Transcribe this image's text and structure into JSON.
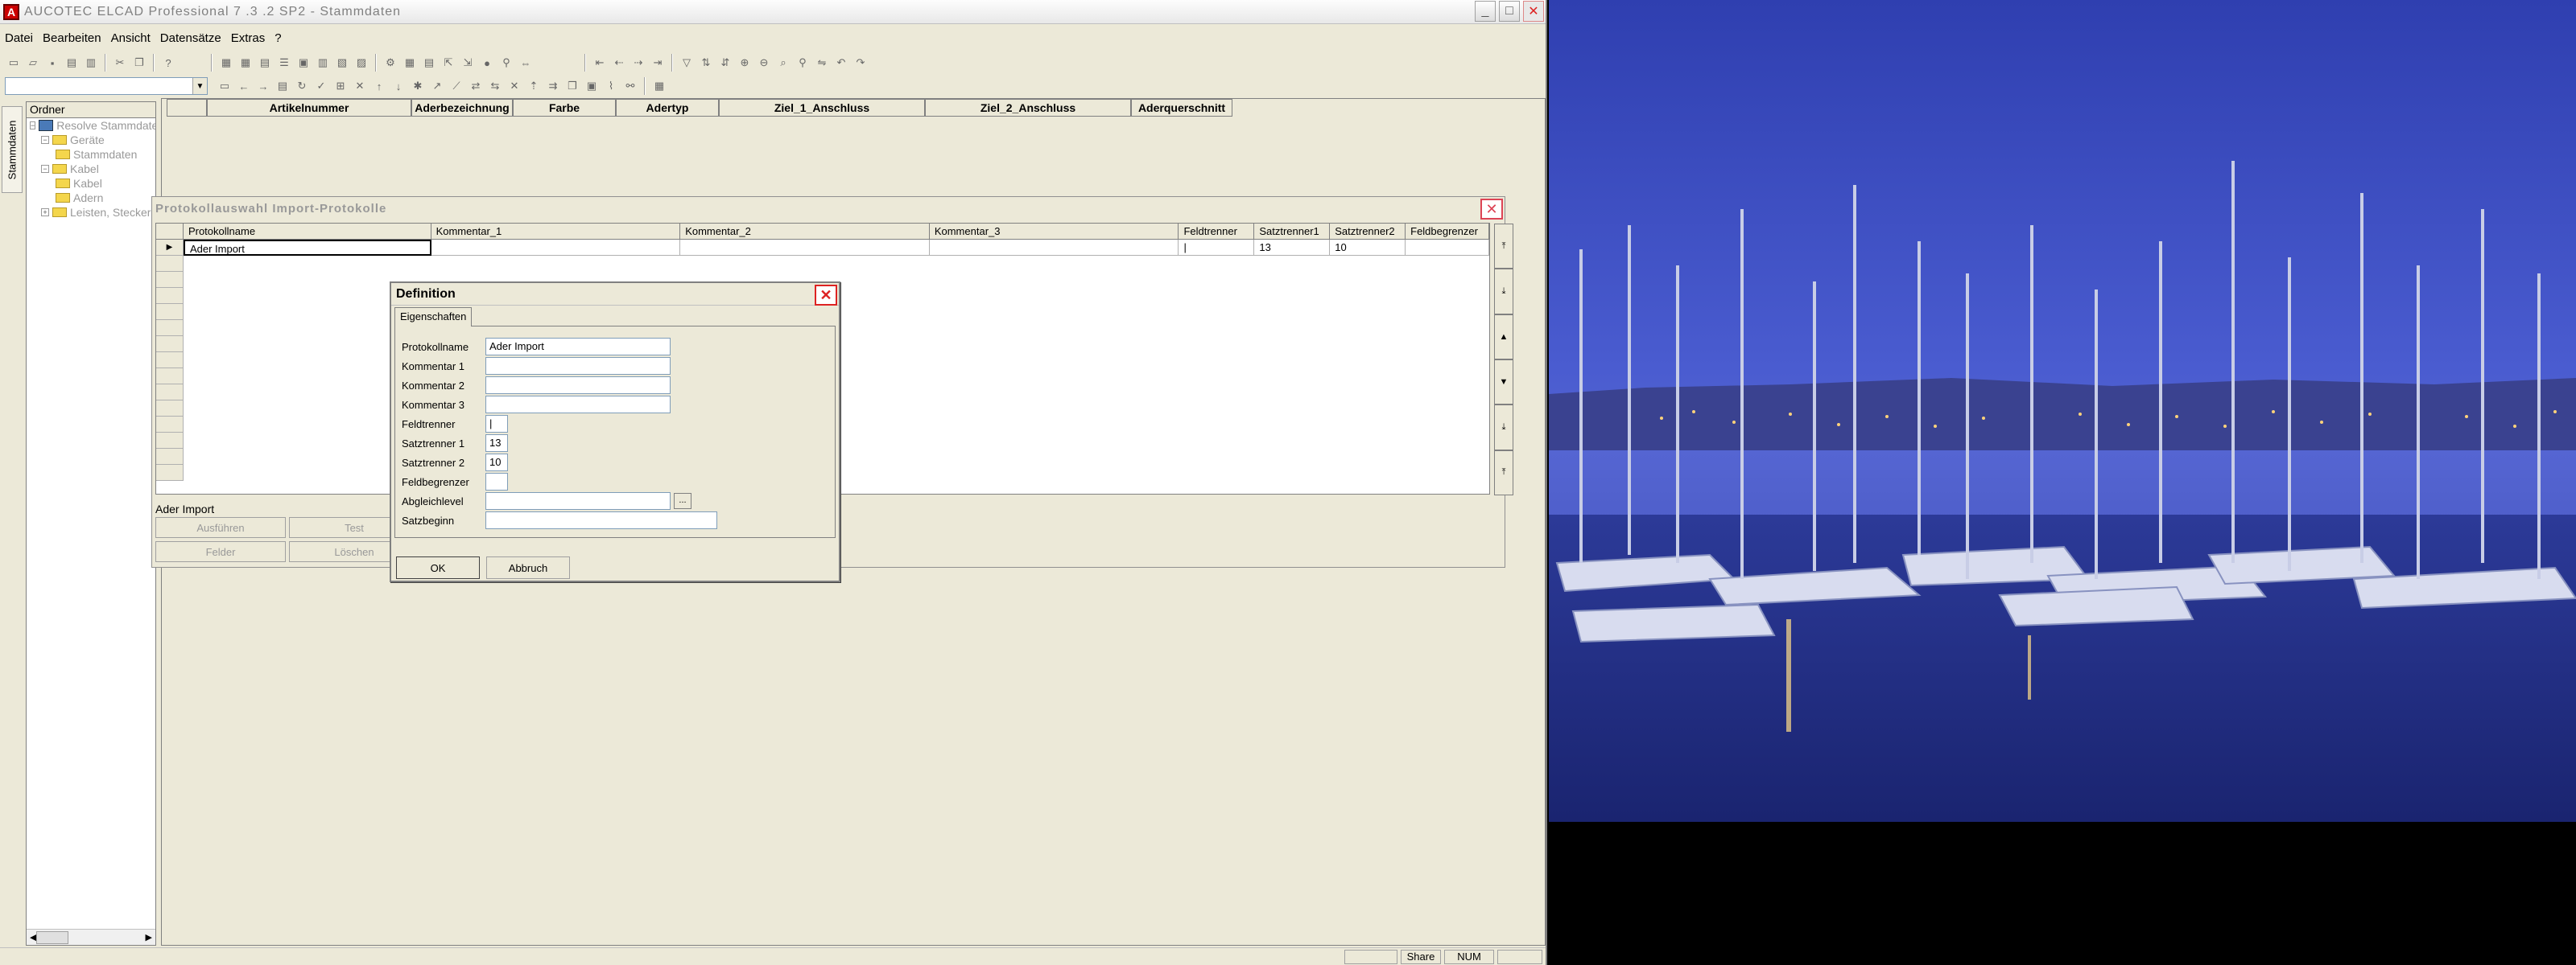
{
  "app": {
    "title": "AUCOTEC     ELCAD Professional 7 .3 .2 SP2 - Stammdaten",
    "icon_glyph": "A"
  },
  "window_buttons": {
    "minimize": "_",
    "maximize": "□",
    "close": "✕"
  },
  "menu": [
    "Datei",
    "Bearbeiten",
    "Ansicht",
    "Datensätze",
    "Extras",
    "?"
  ],
  "side_tab": "Stammdaten",
  "tree": {
    "header": "Ordner",
    "nodes": [
      {
        "label": "Resolve Stammdaten",
        "level": 0,
        "expander": "−",
        "icon": "database-icon"
      },
      {
        "label": "Geräte",
        "level": 1,
        "expander": "−",
        "icon": "folder-icon"
      },
      {
        "label": "Stammdaten",
        "level": 2,
        "expander": "",
        "icon": "folder-icon"
      },
      {
        "label": "Kabel",
        "level": 1,
        "expander": "−",
        "icon": "folder-icon"
      },
      {
        "label": "Kabel",
        "level": 2,
        "expander": "",
        "icon": "folder-icon"
      },
      {
        "label": "Adern",
        "level": 2,
        "expander": "",
        "icon": "folder-icon"
      },
      {
        "label": "Leisten, Stecker",
        "level": 1,
        "expander": "+",
        "icon": "folder-icon"
      }
    ]
  },
  "main_grid": {
    "columns": [
      "Artikelnummer",
      "Aderbezeichnung",
      "Farbe",
      "Adertyp",
      "Ziel_1_Anschluss",
      "Ziel_2_Anschluss",
      "Aderquerschnitt"
    ]
  },
  "protocol_window": {
    "title": "Protokollauswahl Import-Protokolle",
    "close": "✕",
    "columns": [
      "Protokollname",
      "Kommentar_1",
      "Kommentar_2",
      "Kommentar_3",
      "Feldtrenner",
      "Satztrenner1",
      "Satztrenner2",
      "Feldbegrenzer"
    ],
    "rows": [
      {
        "indicator": "▶",
        "cells": [
          "Ader Import",
          "",
          "",
          "",
          "|",
          "13",
          "10",
          ""
        ]
      }
    ],
    "side_buttons": [
      "⤒",
      "⤓",
      "▲",
      "▼",
      "⤓",
      "⤒"
    ],
    "selected_label": "Ader Import",
    "buttons": {
      "run": "Ausführen",
      "test": "Test",
      "fields": "Felder",
      "delete": "Löschen"
    }
  },
  "definition_dialog": {
    "title": "Definition",
    "close": "✕",
    "tab": "Eigenschaften",
    "fields": [
      {
        "label": "Protokollname",
        "value": "Ader Import"
      },
      {
        "label": "Kommentar 1",
        "value": ""
      },
      {
        "label": "Kommentar 2",
        "value": ""
      },
      {
        "label": "Kommentar 3",
        "value": ""
      },
      {
        "label": "Feldtrenner",
        "value": "|"
      },
      {
        "label": "Satztrenner 1",
        "value": "13"
      },
      {
        "label": "Satztrenner 2",
        "value": "10"
      },
      {
        "label": "Feldbegrenzer",
        "value": ""
      },
      {
        "label": "Abgleichlevel",
        "value": ""
      },
      {
        "label": "Satzbeginn",
        "value": ""
      }
    ],
    "browse": "...",
    "ok": "OK",
    "cancel": "Abbruch"
  },
  "statusbar": {
    "share": "Share",
    "num": "NUM"
  }
}
